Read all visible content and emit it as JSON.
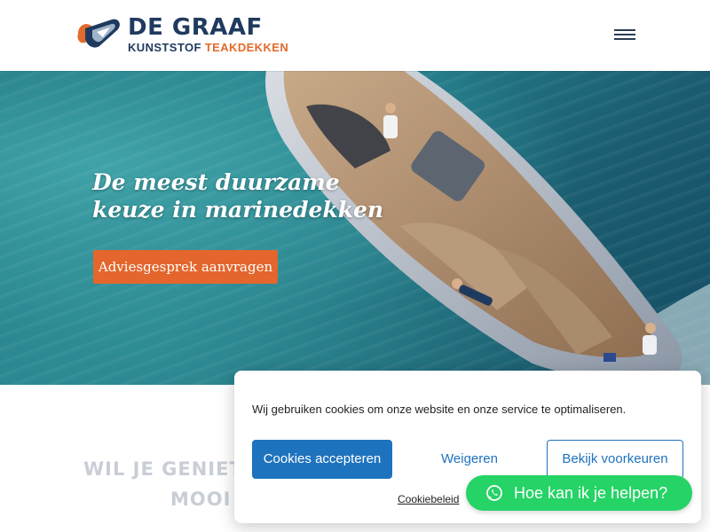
{
  "header": {
    "brand_main": "DE GRAAF",
    "brand_sub_a": "KUNSTSTOF ",
    "brand_sub_b": "TEAKDEKKEN",
    "menu_icon": "hamburger-menu-icon"
  },
  "hero": {
    "title_line1": "De meest duurzame",
    "title_line2": "keuze in marinedekken",
    "cta_label": "Adviesgesprek aanvragen"
  },
  "section": {
    "heading_line1": "WIL JE GENIET",
    "heading_line2": "MOOI"
  },
  "cookie_banner": {
    "message": "Wij gebruiken cookies om onze website en onze service te optimaliseren.",
    "accept_label": "Cookies accepteren",
    "deny_label": "Weigeren",
    "prefs_label": "Bekijk voorkeuren",
    "policy_link": "Cookiebeleid"
  },
  "whatsapp": {
    "label": "Hoe kan ik je helpen?",
    "icon": "whatsapp-icon"
  },
  "colors": {
    "brand_blue": "#1f3a5f",
    "brand_orange": "#e36a2b",
    "cta_orange": "#e4662c",
    "cookie_blue": "#1e73be",
    "whatsapp_green": "#25d366"
  }
}
